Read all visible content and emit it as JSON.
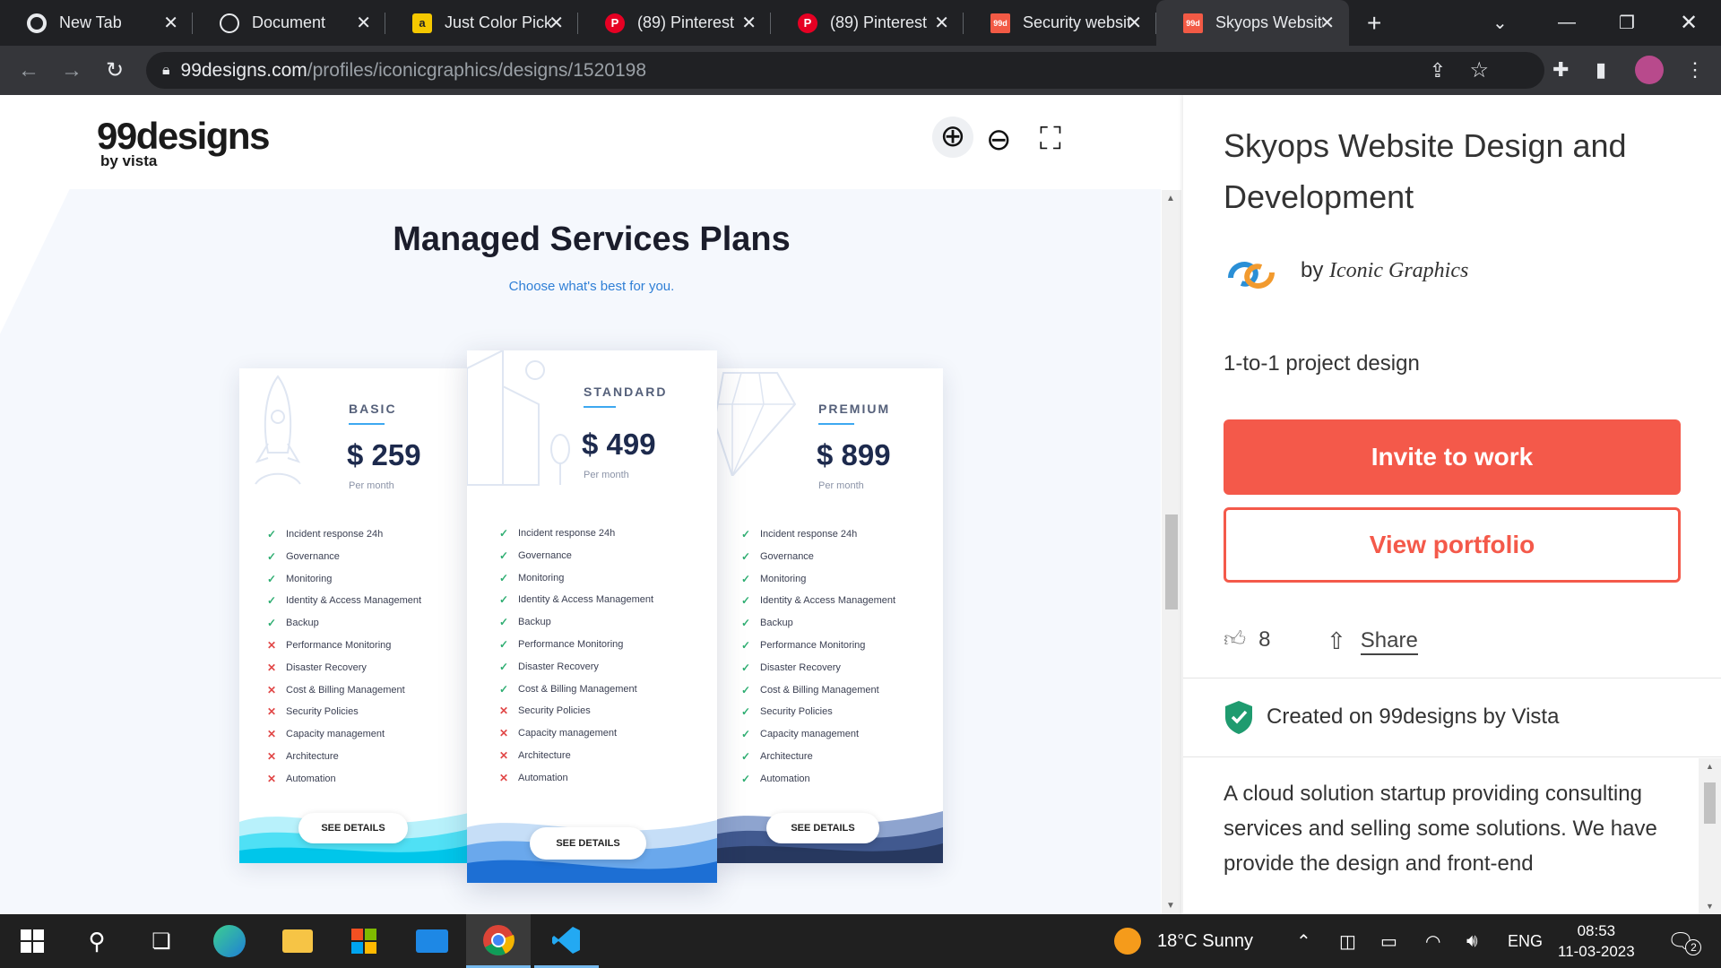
{
  "browser": {
    "tabs": [
      {
        "label": "New Tab",
        "icon": "chrome-icon"
      },
      {
        "label": "Document",
        "icon": "globe-icon"
      },
      {
        "label": "Just Color Picker",
        "icon": "colorpicker-icon"
      },
      {
        "label": "(89) Pinterest",
        "icon": "pinterest-icon"
      },
      {
        "label": "(89) Pinterest",
        "icon": "pinterest-icon"
      },
      {
        "label": "Security website",
        "icon": "99designs-icon"
      },
      {
        "label": "Skyops Website",
        "icon": "99designs-icon"
      }
    ],
    "url_host": "99designs.com",
    "url_path": "/profiles/iconicgraphics/designs/1520198"
  },
  "site": {
    "logo": "99designs",
    "logo_sub": "by vista"
  },
  "design": {
    "heading": "Managed Services Plans",
    "subheading": "Choose what's best for you.",
    "plans": [
      {
        "name": "BASIC",
        "price": "$ 259",
        "period": "Per month",
        "button": "SEE DETAILS",
        "features": [
          {
            "label": "Incident response 24h",
            "included": true
          },
          {
            "label": "Governance",
            "included": true
          },
          {
            "label": "Monitoring",
            "included": true
          },
          {
            "label": "Identity & Access Management",
            "included": true
          },
          {
            "label": "Backup",
            "included": true
          },
          {
            "label": "Performance Monitoring",
            "included": false
          },
          {
            "label": "Disaster Recovery",
            "included": false
          },
          {
            "label": "Cost & Billing Management",
            "included": false
          },
          {
            "label": "Security Policies",
            "included": false
          },
          {
            "label": "Capacity management",
            "included": false
          },
          {
            "label": "Architecture",
            "included": false
          },
          {
            "label": "Automation",
            "included": false
          }
        ]
      },
      {
        "name": "STANDARD",
        "price": "$ 499",
        "period": "Per month",
        "button": "SEE DETAILS",
        "features": [
          {
            "label": "Incident response 24h",
            "included": true
          },
          {
            "label": "Governance",
            "included": true
          },
          {
            "label": "Monitoring",
            "included": true
          },
          {
            "label": "Identity & Access Management",
            "included": true
          },
          {
            "label": "Backup",
            "included": true
          },
          {
            "label": "Performance Monitoring",
            "included": true
          },
          {
            "label": "Disaster Recovery",
            "included": true
          },
          {
            "label": "Cost & Billing Management",
            "included": true
          },
          {
            "label": "Security Policies",
            "included": false
          },
          {
            "label": "Capacity management",
            "included": false
          },
          {
            "label": "Architecture",
            "included": false
          },
          {
            "label": "Automation",
            "included": false
          }
        ]
      },
      {
        "name": "PREMIUM",
        "price": "$ 899",
        "period": "Per month",
        "button": "SEE DETAILS",
        "features": [
          {
            "label": "Incident response 24h",
            "included": true
          },
          {
            "label": "Governance",
            "included": true
          },
          {
            "label": "Monitoring",
            "included": true
          },
          {
            "label": "Identity & Access Management",
            "included": true
          },
          {
            "label": "Backup",
            "included": true
          },
          {
            "label": "Performance Monitoring",
            "included": true
          },
          {
            "label": "Disaster Recovery",
            "included": true
          },
          {
            "label": "Cost & Billing Management",
            "included": true
          },
          {
            "label": "Security Policies",
            "included": true
          },
          {
            "label": "Capacity management",
            "included": true
          },
          {
            "label": "Architecture",
            "included": true
          },
          {
            "label": "Automation",
            "included": true
          }
        ]
      }
    ]
  },
  "panel": {
    "title": "Skyops Website Design and Development",
    "by_prefix": "by",
    "designer": "Iconic Graphics",
    "project_type": "1-to-1 project design",
    "invite_button": "Invite to work",
    "portfolio_button": "View portfolio",
    "likes": "8",
    "share_label": "Share",
    "created": "Created on 99designs by Vista",
    "description": "A cloud solution startup providing consulting services and selling some solutions. We have provide the design and front-end"
  },
  "taskbar": {
    "weather": "18°C  Sunny",
    "lang": "ENG",
    "time": "08:53",
    "date": "11-03-2023",
    "notifications": "2"
  },
  "colors": {
    "accent": "#f4594a",
    "check": "#2fae72",
    "cross": "#e14848",
    "price": "#1d2a4d"
  }
}
